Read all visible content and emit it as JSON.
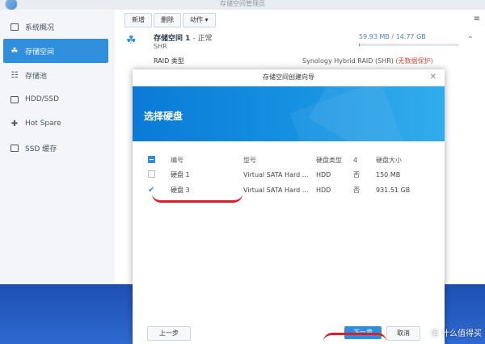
{
  "window": {
    "title": "存储空间管理员"
  },
  "sidebar": {
    "items": [
      {
        "label": "系统概况",
        "icon": "overview-icon"
      },
      {
        "label": "存储空间",
        "icon": "storage-icon",
        "active": true
      },
      {
        "label": "存储池",
        "icon": "pool-icon"
      },
      {
        "label": "HDD/SSD",
        "icon": "disk-icon"
      },
      {
        "label": "Hot Spare",
        "icon": "hot-spare-icon"
      },
      {
        "label": "SSD 缓存",
        "icon": "ssd-cache-icon"
      }
    ]
  },
  "toolbar": {
    "create_label": "新增",
    "delete_label": "删除",
    "action_label": "动作 ▾"
  },
  "storage": {
    "name": "存储空间 1",
    "status": "- 正常",
    "type": "SHR",
    "usage": "59.93 MB / 14.77 GB",
    "usage_fraction": 0.004,
    "raid_label": "RAID 类型",
    "raid_value": "Synology Hybrid RAID (SHR)",
    "raid_warning": "(无数据保护)"
  },
  "modal": {
    "title": "存储空间创建向导",
    "banner_title": "选择硬盘",
    "columns": [
      "编号",
      "型号",
      "硬盘类型",
      "4",
      "硬盘大小"
    ],
    "rows": [
      {
        "id": "硬盘 1",
        "model": "Virtual SATA Hard ...",
        "type": "HDD",
        "flag": "否",
        "size": "150 MB",
        "checked": false
      },
      {
        "id": "硬盘 3",
        "model": "Virtual SATA Hard ...",
        "type": "HDD",
        "flag": "否",
        "size": "931.51 GB",
        "checked": true
      }
    ],
    "prev_label": "上一步",
    "next_label": "下一步",
    "cancel_label": "取消"
  },
  "colors": {
    "accent": "#2f8fdc",
    "annotation": "#e01b2c"
  },
  "watermark": "值 什么值得买"
}
